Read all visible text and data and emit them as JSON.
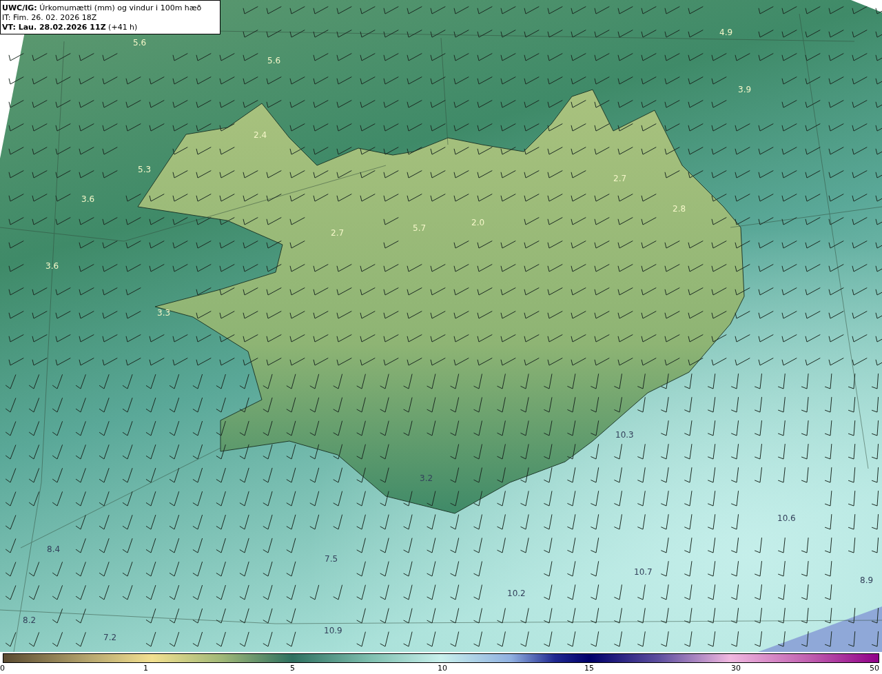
{
  "header": {
    "title": "**UWC/IG:** Úrkomumætti (mm) og vindur i 100m hæð",
    "init_time": "IT: Fim. 26. 02. 2026 18Z",
    "valid_time": "**VT: Lau. 28.02.2026 11Z** (+41 h)"
  },
  "map": {
    "value_labels": [
      {
        "text": "5.6"
      },
      {
        "text": "5.6"
      },
      {
        "text": "4.9"
      },
      {
        "text": "3.9"
      },
      {
        "text": "2.4"
      },
      {
        "text": "5.3"
      },
      {
        "text": "3.6"
      },
      {
        "text": "2.7"
      },
      {
        "text": "5.7"
      },
      {
        "text": "2.0"
      },
      {
        "text": "2.7"
      },
      {
        "text": "2.8"
      },
      {
        "text": "3.6"
      },
      {
        "text": "3.3"
      },
      {
        "text": "10.3"
      },
      {
        "text": "3.2"
      },
      {
        "text": "10.6"
      },
      {
        "text": "8.4"
      },
      {
        "text": "7.5"
      },
      {
        "text": "10.7"
      },
      {
        "text": "10.2"
      },
      {
        "text": "8.9"
      },
      {
        "text": "8.2"
      },
      {
        "text": "10.9"
      },
      {
        "text": "7.2"
      }
    ]
  },
  "colorbar": {
    "ticks": [
      "0",
      "1",
      "5",
      "10",
      "15",
      "30",
      "50"
    ]
  }
}
